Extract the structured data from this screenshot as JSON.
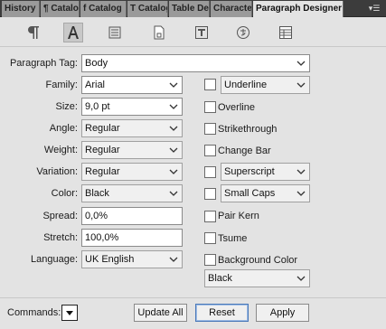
{
  "tabs": [
    {
      "label": "History"
    },
    {
      "label": "¶ Catalog"
    },
    {
      "label": "f Catalog"
    },
    {
      "label": "T Catalog"
    },
    {
      "label": "Table De"
    },
    {
      "label": "Characte"
    },
    {
      "label": "Paragraph Designer"
    }
  ],
  "toolbar_icons": [
    "paragraph-icon",
    "character-icon",
    "text-block-icon",
    "page-icon",
    "text-frame-icon",
    "asian-text-icon",
    "table-icon"
  ],
  "form": {
    "paragraph_tag": {
      "label": "Paragraph Tag:",
      "value": "Body"
    },
    "family": {
      "label": "Family:",
      "value": "Arial"
    },
    "size": {
      "label": "Size:",
      "value": "9,0 pt"
    },
    "angle": {
      "label": "Angle:",
      "value": "Regular"
    },
    "weight": {
      "label": "Weight:",
      "value": "Regular"
    },
    "variation": {
      "label": "Variation:",
      "value": "Regular"
    },
    "color": {
      "label": "Color:",
      "value": "Black"
    },
    "spread": {
      "label": "Spread:",
      "value": "0,0%"
    },
    "stretch": {
      "label": "Stretch:",
      "value": "100,0%"
    },
    "language": {
      "label": "Language:",
      "value": "UK English"
    }
  },
  "options": {
    "underline": {
      "value": "Underline"
    },
    "overline": {
      "label": "Overline"
    },
    "strikethrough": {
      "label": "Strikethrough"
    },
    "change_bar": {
      "label": "Change Bar"
    },
    "superscript": {
      "value": "Superscript"
    },
    "small_caps": {
      "value": "Small Caps"
    },
    "pair_kern": {
      "label": "Pair Kern"
    },
    "tsume": {
      "label": "Tsume"
    },
    "background_color": {
      "label": "Background Color",
      "value": "Black"
    }
  },
  "bottom": {
    "commands_label": "Commands:",
    "update_all": "Update All",
    "reset": "Reset",
    "apply": "Apply"
  },
  "colors": {
    "panel": "#e3e3e3",
    "tabbar": "#3c3c3c",
    "focus": "#4a78b8"
  }
}
